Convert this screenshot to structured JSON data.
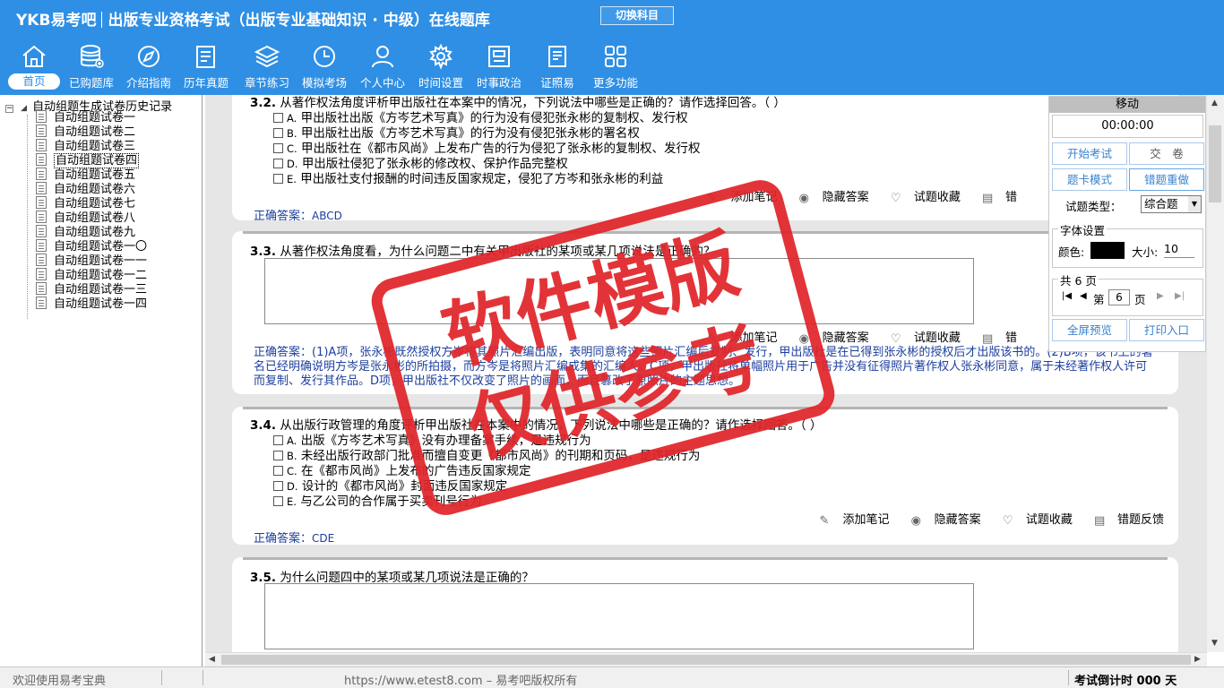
{
  "app": {
    "brand": "YKB易考吧",
    "title": "出版专业资格考试（出版专业基础知识 · 中级）在线题库",
    "switch_label": "切换科目"
  },
  "nav": [
    {
      "label": "首页",
      "icon": "home-icon",
      "active": true
    },
    {
      "label": "已购题库",
      "icon": "database-icon"
    },
    {
      "label": "介绍指南",
      "icon": "compass-icon"
    },
    {
      "label": "历年真题",
      "icon": "document-list-icon"
    },
    {
      "label": "章节练习",
      "icon": "layers-icon"
    },
    {
      "label": "模拟考场",
      "icon": "clock-icon"
    },
    {
      "label": "个人中心",
      "icon": "user-icon"
    },
    {
      "label": "时间设置",
      "icon": "gear-icon"
    },
    {
      "label": "时事政治",
      "icon": "news-icon"
    },
    {
      "label": "证照易",
      "icon": "certificate-icon"
    },
    {
      "label": "更多功能",
      "icon": "grid-icon"
    }
  ],
  "tree": {
    "root": "自动组题生成试卷历史记录",
    "items": [
      "自动组题试卷一",
      "自动组题试卷二",
      "自动组题试卷三",
      "自动组题试卷四",
      "自动组题试卷五",
      "自动组题试卷六",
      "自动组题试卷七",
      "自动组题试卷八",
      "自动组题试卷九",
      "自动组题试卷一〇",
      "自动组题试卷一一",
      "自动组题试卷一二",
      "自动组题试卷一三",
      "自动组题试卷一四"
    ],
    "selected_index": 3
  },
  "questions": {
    "q32": {
      "num": "3.2.",
      "text": "从著作权法角度评析甲出版社在本案中的情况，下列说法中哪些是正确的？请作选择回答。（ ）",
      "options": [
        {
          "key": "A.",
          "text": "甲出版社出版《方岑艺术写真》的行为没有侵犯张永彬的复制权、发行权"
        },
        {
          "key": "B.",
          "text": "甲出版社出版《方岑艺术写真》的行为没有侵犯张永彬的署名权"
        },
        {
          "key": "C.",
          "text": "甲出版社在《都市风尚》上发布广告的行为侵犯了张永彬的复制权、发行权"
        },
        {
          "key": "D.",
          "text": "甲出版社侵犯了张永彬的修改权、保护作品完整权"
        },
        {
          "key": "E.",
          "text": "甲出版社支付报酬的时间违反国家规定，侵犯了方岑和张永彬的利益"
        }
      ],
      "answer_label": "正确答案：",
      "answer": "ABCD"
    },
    "q33": {
      "num": "3.3.",
      "text": "从著作权法角度看，为什么问题二中有关甲出版社的某项或某几项说法是正确的？",
      "answer_label": "正确答案：",
      "answer": "(1)A项，张永彬既然授权方岑将其照片汇编出版，表明同意将这些照片汇编后复制、发行，甲出版社是在已得到张永彬的授权后才出版该书的。(2)B项，该书上的署名已经明确说明方岑是张永彬的所拍摄，而方岑是将照片汇编成集的汇编人。C项，甲出版社将单幅照片用于广告并没有征得照片著作权人张永彬同意，属于未经著作权人许可而复制、发行其作品。D项，甲出版社不仅改变了照片的画面，而且篡改了原照片的主题思想。"
    },
    "q34": {
      "num": "3.4.",
      "text": "从出版行政管理的角度评析甲出版社在本案中的情况，下列说法中哪些是正确的？请作选择回答。（ ）",
      "options": [
        {
          "key": "A.",
          "text": "出版《方岑艺术写真》没有办理备案手续，是违规行为"
        },
        {
          "key": "B.",
          "text": "未经出版行政部门批准而擅自变更《都市风尚》的刊期和页码，是违规行为"
        },
        {
          "key": "C.",
          "text": "在《都市风尚》上发布的广告违反国家规定"
        },
        {
          "key": "D.",
          "text": "设计的《都市风尚》封面违反国家规定"
        },
        {
          "key": "E.",
          "text": "与乙公司的合作属于买卖刊号行为"
        }
      ],
      "answer_label": "正确答案：",
      "answer": "CDE"
    },
    "q35": {
      "num": "3.5.",
      "text": "为什么问题四中的某项或某几项说法是正确的？"
    }
  },
  "tools": {
    "note": "添加笔记",
    "hide": "隐藏答案",
    "fav": "试题收藏",
    "feedback": "错题反馈",
    "feedback_short": "错"
  },
  "panel": {
    "header": "移动",
    "timer": "00:00:00",
    "start_exam": "开始考试",
    "submit": "交　卷",
    "card_mode": "题卡模式",
    "redo_wrong": "错题重做",
    "type_label": "试题类型：",
    "type_value": "综合题",
    "font_legend": "字体设置",
    "color_label": "颜色:",
    "color_value": "#000000",
    "size_label": "大小:",
    "size_value": "10",
    "pages_legend": "共 6 页",
    "page_prefix": "第",
    "page_value": "6",
    "page_suffix": "页",
    "fullscreen": "全屏预览",
    "print": "打印入口"
  },
  "status": {
    "welcome": "欢迎使用易考宝典",
    "url": "https://www.etest8.com – 易考吧版权所有",
    "countdown": "考试倒计时 000 天"
  },
  "watermark": {
    "line1": "软件模版",
    "line2": "仅供参考"
  },
  "colors": {
    "topbar": "#2f8fe4",
    "answer": "#1d3f9d",
    "stamp": "#e0252a"
  }
}
